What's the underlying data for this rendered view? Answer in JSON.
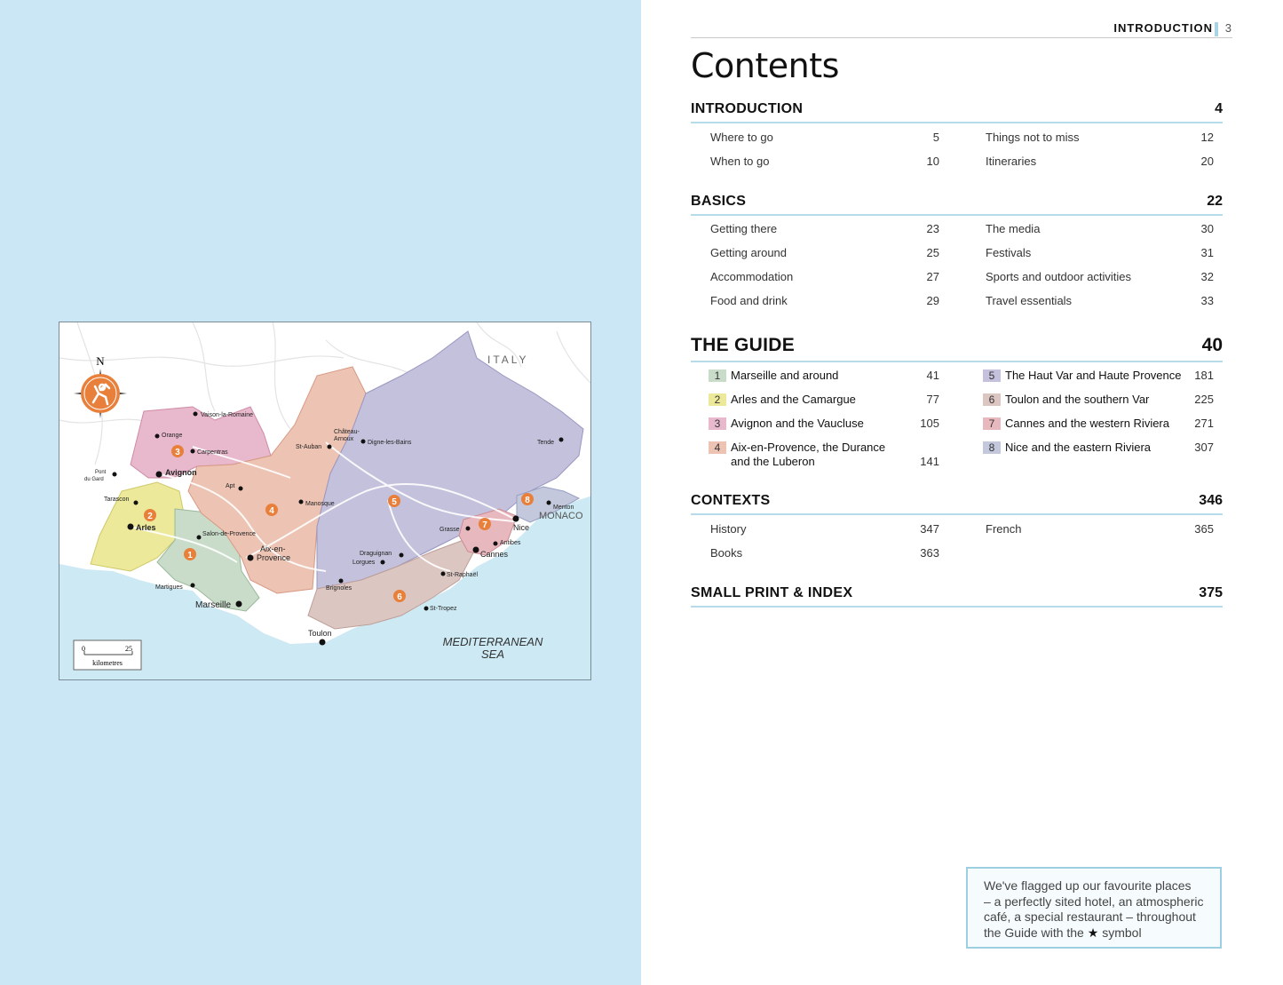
{
  "running_head": {
    "label": "INTRODUCTION",
    "page": "3"
  },
  "title": "Contents",
  "sections": {
    "introduction": {
      "title": "INTRODUCTION",
      "page": "4",
      "left": [
        {
          "label": "Where to go",
          "page": "5"
        },
        {
          "label": "When to go",
          "page": "10"
        }
      ],
      "right": [
        {
          "label": "Things not to miss",
          "page": "12"
        },
        {
          "label": "Itineraries",
          "page": "20"
        }
      ]
    },
    "basics": {
      "title": "BASICS",
      "page": "22",
      "left": [
        {
          "label": "Getting there",
          "page": "23"
        },
        {
          "label": "Getting around",
          "page": "25"
        },
        {
          "label": "Accommodation",
          "page": "27"
        },
        {
          "label": "Food and drink",
          "page": "29"
        }
      ],
      "right": [
        {
          "label": "The media",
          "page": "30"
        },
        {
          "label": "Festivals",
          "page": "31"
        },
        {
          "label": "Sports and outdoor activities",
          "page": "32"
        },
        {
          "label": "Travel essentials",
          "page": "33"
        }
      ]
    },
    "guide": {
      "title": "THE GUIDE",
      "page": "40",
      "left": [
        {
          "num": "1",
          "label": "Marseille and around",
          "page": "41",
          "color": "#c9dcc9"
        },
        {
          "num": "2",
          "label": "Arles and the Camargue",
          "page": "77",
          "color": "#ece99a"
        },
        {
          "num": "3",
          "label": "Avignon and the Vaucluse",
          "page": "105",
          "color": "#e8b8cc"
        },
        {
          "num": "4",
          "label": "Aix-en-Provence, the Durance",
          "label2": "and the Luberon",
          "page": "141",
          "color": "#edc3b3"
        }
      ],
      "right": [
        {
          "num": "5",
          "label": "The Haut Var and Haute Provence",
          "page": "181",
          "color": "#c3c1db"
        },
        {
          "num": "6",
          "label": "Toulon and the southern Var",
          "page": "225",
          "color": "#dcc6c2"
        },
        {
          "num": "7",
          "label": "Cannes and the western Riviera",
          "page": "271",
          "color": "#e8b8bf"
        },
        {
          "num": "8",
          "label": "Nice and the eastern Riviera",
          "page": "307",
          "color": "#c3c8dc"
        }
      ]
    },
    "contexts": {
      "title": "CONTEXTS",
      "page": "346",
      "left": [
        {
          "label": "History",
          "page": "347"
        },
        {
          "label": "Books",
          "page": "363"
        }
      ],
      "right": [
        {
          "label": "French",
          "page": "365"
        }
      ]
    },
    "small_print": {
      "title": "SMALL PRINT & INDEX",
      "page": "375"
    }
  },
  "callout": {
    "line1": "We've flagged up our favourite places",
    "line2": "– a perfectly sited hotel, an atmospheric",
    "line3": "café, a special restaurant – throughout",
    "line4_a": "the Guide with the",
    "star": "★",
    "line4_b": "symbol"
  },
  "map": {
    "compass": "N",
    "country": "ITALY",
    "monaco": "MONACO",
    "sea_1": "MEDITERRANEAN",
    "sea_2": "SEA",
    "scale_0": "0",
    "scale_25": "25",
    "scale_unit": "kilometres",
    "towns": {
      "vaison": "Vaison-la-Romaine",
      "orange": "Orange",
      "carpentras": "Carpentras",
      "avignon": "Avignon",
      "pont_1": "Pont",
      "pont_2": "du Gard",
      "tarascon": "Tarascon",
      "arles": "Arles",
      "apt": "Apt",
      "manosque": "Manosque",
      "salon": "Salon-de-Provence",
      "aix_1": "Aix-en-",
      "aix_2": "Provence",
      "martigues": "Martigues",
      "marseille": "Marseille",
      "brignoles": "Brignoles",
      "toulon": "Toulon",
      "st_auban": "St-Auban",
      "chateau_1": "Château-",
      "chateau_2": "Arnoux",
      "digne": "Digne-les-Bains",
      "draguignan": "Draguignan",
      "lorgues": "Lorgues",
      "grasse": "Grasse",
      "antibes": "Antibes",
      "cannes": "Cannes",
      "nice": "Nice",
      "menton": "Menton",
      "tende": "Tende",
      "st_raphael": "St-Raphaël",
      "st_tropez": "St-Tropez"
    },
    "region_numbers": [
      "1",
      "2",
      "3",
      "4",
      "5",
      "6",
      "7",
      "8"
    ],
    "colors": {
      "sea": "#cde9f3",
      "land": "#ffffff",
      "r1": "#c9dcc9",
      "r2": "#ece99a",
      "r3": "#e8b8cc",
      "r4": "#edc3b3",
      "r5": "#c3c1db",
      "r6": "#dcc6c2",
      "r7": "#e8b8bf",
      "r8": "#c3c8dc",
      "marker": "#e87f3a"
    }
  }
}
